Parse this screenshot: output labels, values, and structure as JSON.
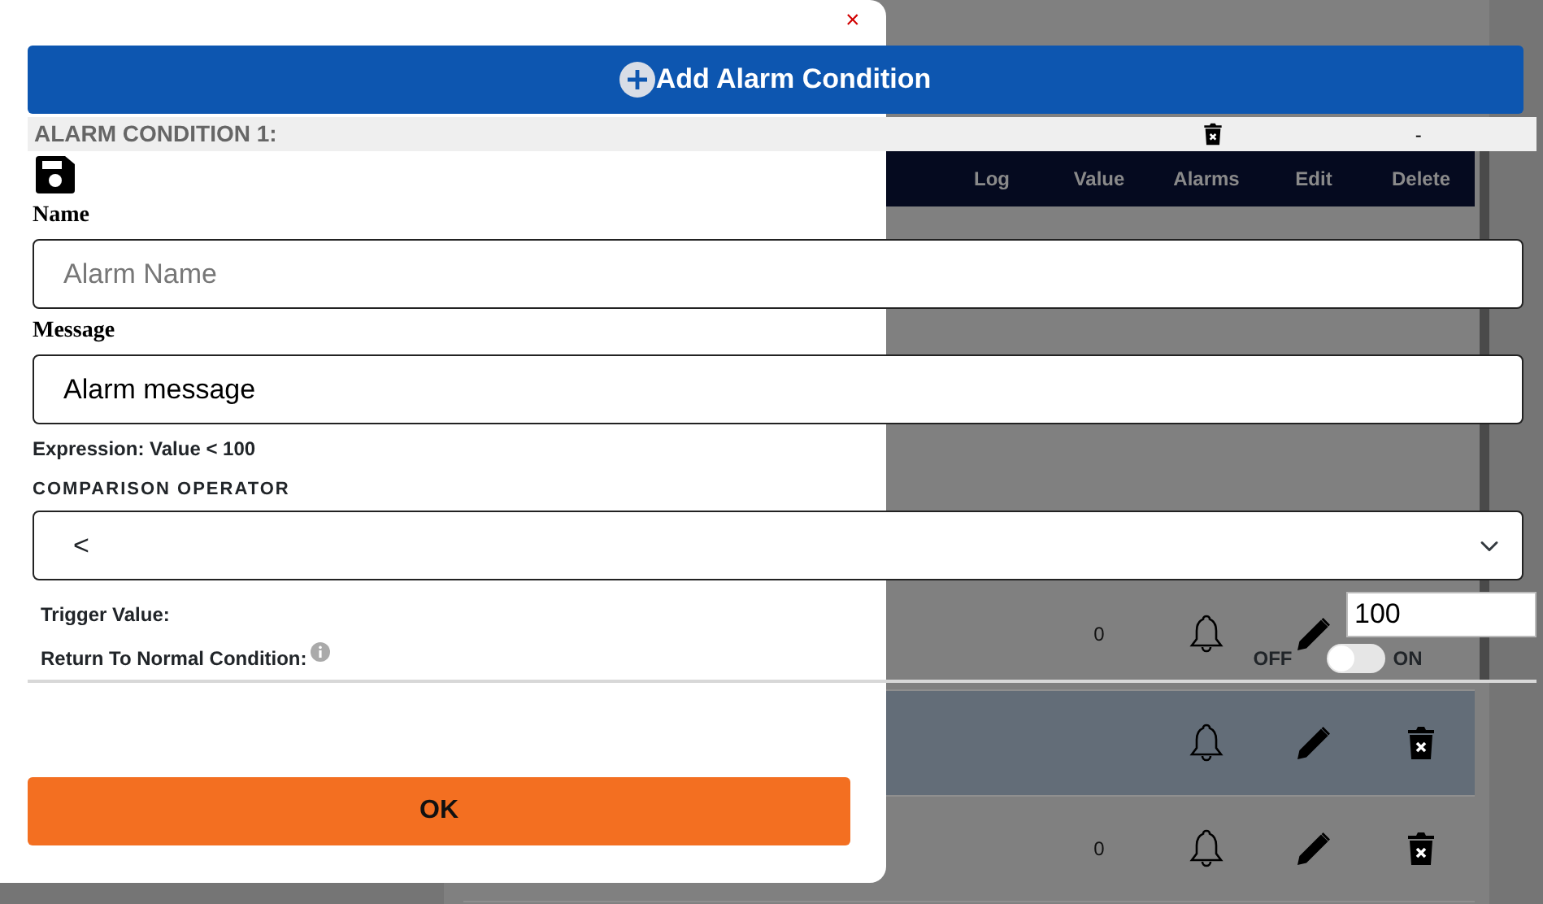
{
  "background_table": {
    "columns": [
      "Log",
      "Value",
      "Alarms",
      "Edit",
      "Delete"
    ],
    "rows": [
      {
        "value": "0",
        "selected": false
      },
      {
        "selected": true
      },
      {
        "value": "0",
        "selected": false
      }
    ]
  },
  "modal": {
    "close": "×",
    "add_button": "Add Alarm Condition",
    "condition_title": "ALARM CONDITION 1:",
    "collapse": "-",
    "fields": [
      {
        "label": "Name",
        "placeholder": "Alarm Name"
      },
      {
        "label": "Message",
        "value": "Alarm message"
      }
    ],
    "expression": "Expression: Value < 100",
    "operator_label": "COMPARISON OPERATOR",
    "operator": "<",
    "trigger_label": "Trigger Value:",
    "trigger_value": "100",
    "return_label": "Return To Normal Condition:",
    "return_switch": {
      "off_label": "OFF",
      "on_label": "ON",
      "on": false
    },
    "ok": "OK"
  }
}
